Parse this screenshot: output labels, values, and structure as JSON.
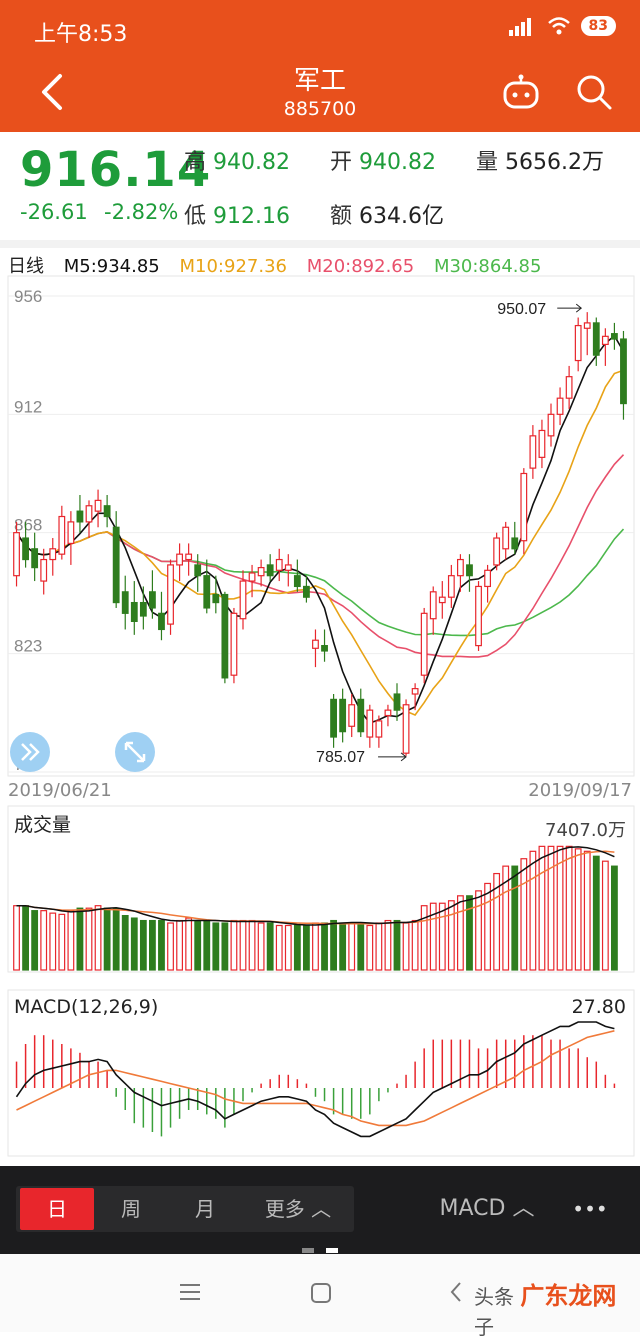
{
  "status": {
    "time": "上午8:53",
    "battery": "83"
  },
  "header": {
    "title": "军工",
    "code": "885700"
  },
  "quote": {
    "price": "916.14",
    "change": "-26.61",
    "change_pct": "-2.82%",
    "high_label": "高",
    "high": "940.82",
    "open_label": "开",
    "open": "940.82",
    "volume_label": "量",
    "volume": "5656.2万",
    "low_label": "低",
    "low": "912.16",
    "amount_label": "额",
    "amount": "634.6亿"
  },
  "ma": {
    "period": "日线",
    "m5": "M5:934.85",
    "m10": "M10:927.36",
    "m20": "M20:892.65",
    "m30": "M30:864.85",
    "colors": {
      "m5": "#111111",
      "m10": "#e8a317",
      "m20": "#e8506b",
      "m30": "#4cb84c",
      "up": "#e8262c",
      "down": "#2e7d1e"
    }
  },
  "chart": {
    "y_ticks": [
      "956",
      "912",
      "868",
      "823",
      "779"
    ],
    "high_annotation": "950.07",
    "low_annotation": "785.07",
    "date_start": "2019/06/21",
    "date_end": "2019/09/17"
  },
  "volume": {
    "label": "成交量",
    "value": "7407.0万"
  },
  "macd": {
    "label": "MACD(12,26,9)",
    "value": "27.80"
  },
  "tabs": {
    "day": "日",
    "week": "周",
    "month": "月",
    "more": "更多 ︿",
    "indicator": "MACD ︿",
    "menu": "•••"
  },
  "watermark": {
    "prefix": "头条",
    "brand": "广东龙网",
    "suffix": "子"
  },
  "chart_data": {
    "type": "candlestick",
    "x_range": [
      "2019/06/21",
      "2019/09/17"
    ],
    "ylim": [
      779,
      956
    ],
    "y_ticks": [
      956,
      912,
      868,
      823,
      779
    ],
    "candles": [
      {
        "o": 852,
        "h": 872,
        "l": 848,
        "c": 868
      },
      {
        "o": 866,
        "h": 872,
        "l": 855,
        "c": 858
      },
      {
        "o": 862,
        "h": 868,
        "l": 850,
        "c": 855
      },
      {
        "o": 850,
        "h": 862,
        "l": 845,
        "c": 858
      },
      {
        "o": 858,
        "h": 866,
        "l": 852,
        "c": 862
      },
      {
        "o": 860,
        "h": 878,
        "l": 858,
        "c": 874
      },
      {
        "o": 864,
        "h": 876,
        "l": 856,
        "c": 872
      },
      {
        "o": 876,
        "h": 882,
        "l": 868,
        "c": 872
      },
      {
        "o": 872,
        "h": 880,
        "l": 866,
        "c": 878
      },
      {
        "o": 876,
        "h": 884,
        "l": 870,
        "c": 880
      },
      {
        "o": 878,
        "h": 882,
        "l": 870,
        "c": 874
      },
      {
        "o": 870,
        "h": 876,
        "l": 840,
        "c": 842
      },
      {
        "o": 846,
        "h": 852,
        "l": 832,
        "c": 838
      },
      {
        "o": 842,
        "h": 850,
        "l": 830,
        "c": 835
      },
      {
        "o": 842,
        "h": 848,
        "l": 832,
        "c": 837
      },
      {
        "o": 846,
        "h": 854,
        "l": 836,
        "c": 840
      },
      {
        "o": 838,
        "h": 846,
        "l": 828,
        "c": 832
      },
      {
        "o": 834,
        "h": 858,
        "l": 830,
        "c": 856
      },
      {
        "o": 856,
        "h": 864,
        "l": 850,
        "c": 860
      },
      {
        "o": 858,
        "h": 864,
        "l": 852,
        "c": 860
      },
      {
        "o": 856,
        "h": 860,
        "l": 846,
        "c": 852
      },
      {
        "o": 852,
        "h": 858,
        "l": 838,
        "c": 840
      },
      {
        "o": 845,
        "h": 852,
        "l": 838,
        "c": 842
      },
      {
        "o": 845,
        "h": 846,
        "l": 812,
        "c": 814
      },
      {
        "o": 815,
        "h": 840,
        "l": 812,
        "c": 838
      },
      {
        "o": 836,
        "h": 854,
        "l": 832,
        "c": 850
      },
      {
        "o": 850,
        "h": 856,
        "l": 844,
        "c": 853
      },
      {
        "o": 852,
        "h": 858,
        "l": 848,
        "c": 855
      },
      {
        "o": 856,
        "h": 860,
        "l": 850,
        "c": 852
      },
      {
        "o": 854,
        "h": 862,
        "l": 850,
        "c": 858
      },
      {
        "o": 854,
        "h": 860,
        "l": 848,
        "c": 856
      },
      {
        "o": 852,
        "h": 858,
        "l": 846,
        "c": 848
      },
      {
        "o": 848,
        "h": 852,
        "l": 842,
        "c": 844
      },
      {
        "o": 825,
        "h": 832,
        "l": 818,
        "c": 828
      },
      {
        "o": 826,
        "h": 832,
        "l": 820,
        "c": 824
      },
      {
        "o": 806,
        "h": 808,
        "l": 788,
        "c": 792
      },
      {
        "o": 806,
        "h": 810,
        "l": 790,
        "c": 794
      },
      {
        "o": 796,
        "h": 808,
        "l": 792,
        "c": 804
      },
      {
        "o": 806,
        "h": 810,
        "l": 792,
        "c": 794
      },
      {
        "o": 792,
        "h": 804,
        "l": 788,
        "c": 802
      },
      {
        "o": 792,
        "h": 800,
        "l": 788,
        "c": 798
      },
      {
        "o": 800,
        "h": 804,
        "l": 796,
        "c": 802
      },
      {
        "o": 808,
        "h": 812,
        "l": 798,
        "c": 802
      },
      {
        "o": 786,
        "h": 806,
        "l": 785,
        "c": 804
      },
      {
        "o": 808,
        "h": 812,
        "l": 802,
        "c": 810
      },
      {
        "o": 815,
        "h": 840,
        "l": 812,
        "c": 838
      },
      {
        "o": 836,
        "h": 848,
        "l": 830,
        "c": 846
      },
      {
        "o": 842,
        "h": 850,
        "l": 836,
        "c": 844
      },
      {
        "o": 844,
        "h": 856,
        "l": 840,
        "c": 852
      },
      {
        "o": 852,
        "h": 860,
        "l": 846,
        "c": 858
      },
      {
        "o": 856,
        "h": 860,
        "l": 846,
        "c": 852
      },
      {
        "o": 826,
        "h": 850,
        "l": 824,
        "c": 848
      },
      {
        "o": 848,
        "h": 856,
        "l": 842,
        "c": 854
      },
      {
        "o": 856,
        "h": 868,
        "l": 854,
        "c": 866
      },
      {
        "o": 862,
        "h": 872,
        "l": 858,
        "c": 870
      },
      {
        "o": 866,
        "h": 872,
        "l": 860,
        "c": 862
      },
      {
        "o": 865,
        "h": 892,
        "l": 860,
        "c": 890
      },
      {
        "o": 892,
        "h": 908,
        "l": 888,
        "c": 904
      },
      {
        "o": 896,
        "h": 910,
        "l": 892,
        "c": 906
      },
      {
        "o": 904,
        "h": 916,
        "l": 900,
        "c": 912
      },
      {
        "o": 912,
        "h": 922,
        "l": 908,
        "c": 918
      },
      {
        "o": 918,
        "h": 930,
        "l": 914,
        "c": 926
      },
      {
        "o": 932,
        "h": 948,
        "l": 928,
        "c": 945
      },
      {
        "o": 944,
        "h": 950,
        "l": 934,
        "c": 946
      },
      {
        "o": 946,
        "h": 948,
        "l": 930,
        "c": 934
      },
      {
        "o": 938,
        "h": 944,
        "l": 930,
        "c": 941
      },
      {
        "o": 942,
        "h": 946,
        "l": 936,
        "c": 940
      },
      {
        "o": 940,
        "h": 943,
        "l": 910,
        "c": 916
      }
    ],
    "volume": [
      52,
      52,
      48,
      48,
      46,
      45,
      48,
      50,
      50,
      52,
      50,
      50,
      44,
      42,
      40,
      40,
      40,
      38,
      40,
      42,
      40,
      40,
      38,
      38,
      40,
      40,
      40,
      38,
      38,
      36,
      36,
      36,
      36,
      38,
      38,
      40,
      38,
      38,
      38,
      36,
      38,
      40,
      40,
      38,
      40,
      52,
      54,
      54,
      56,
      60,
      60,
      64,
      70,
      78,
      84,
      84,
      90,
      96,
      100,
      100,
      100,
      100,
      98,
      96,
      92,
      88,
      84
    ],
    "macd_dif": [
      -4,
      2,
      6,
      8,
      9,
      10,
      11,
      12,
      12,
      13,
      12,
      6,
      2,
      -2,
      -4,
      -6,
      -8,
      -7,
      -6,
      -5,
      -6,
      -8,
      -10,
      -14,
      -12,
      -10,
      -8,
      -6,
      -5,
      -4,
      -4,
      -5,
      -6,
      -10,
      -12,
      -16,
      -18,
      -20,
      -22,
      -22,
      -20,
      -18,
      -16,
      -14,
      -10,
      -6,
      -2,
      0,
      2,
      4,
      6,
      6,
      8,
      12,
      14,
      16,
      20,
      22,
      24,
      26,
      28,
      28,
      30,
      30,
      30,
      28,
      27
    ],
    "macd_dea": [
      -10,
      -8,
      -6,
      -4,
      -2,
      0,
      2,
      4,
      6,
      7,
      8,
      8,
      7,
      6,
      5,
      4,
      3,
      2,
      1,
      0,
      -1,
      -2,
      -3,
      -5,
      -6,
      -7,
      -7,
      -7,
      -7,
      -7,
      -7,
      -7,
      -7,
      -8,
      -9,
      -10,
      -12,
      -13,
      -15,
      -16,
      -17,
      -17,
      -17,
      -17,
      -16,
      -15,
      -13,
      -11,
      -9,
      -7,
      -5,
      -3,
      -1,
      1,
      3,
      5,
      8,
      10,
      12,
      15,
      17,
      19,
      21,
      23,
      24,
      25,
      26
    ]
  }
}
